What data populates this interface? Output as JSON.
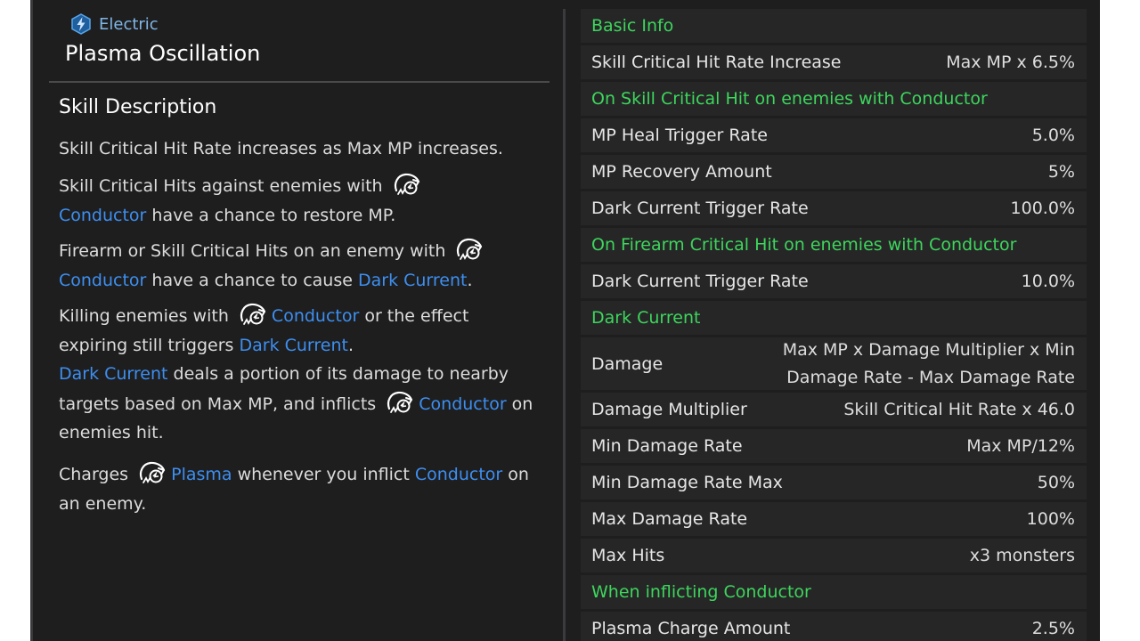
{
  "header": {
    "element_label": "Electric",
    "element_icon": "electric-bolt-icon",
    "skill_name": "Plasma Oscillation"
  },
  "description": {
    "title": "Skill Description",
    "p1": "Skill Critical Hit Rate increases as Max MP increases.",
    "p2_a": "Skill Critical Hits against enemies with",
    "p2_link": "Conductor",
    "p2_b": " have a chance to restore MP.",
    "p3_a": "Firearm or Skill Critical Hits on an enemy with",
    "p3_link1": "Conductor",
    "p3_b": " have a chance to cause ",
    "p3_link2": "Dark Current",
    "p3_c": ".",
    "p4_a": "Killing enemies with",
    "p4_link1": "Conductor",
    "p4_b": " or the effect expiring still triggers ",
    "p4_link2": "Dark Current",
    "p4_c": ".",
    "p5_link1": "Dark Current",
    "p5_a": " deals a portion of its damage to nearby targets based on Max MP, and inflicts",
    "p5_link2": "Conductor",
    "p5_b": " on enemies hit.",
    "p6_a": "Charges",
    "p6_link1": "Plasma",
    "p6_b": " whenever you inflict ",
    "p6_link2": "Conductor",
    "p6_c": " on an enemy."
  },
  "stats": {
    "sec_basic": "Basic Info",
    "r1_label": "Skill Critical Hit Rate Increase",
    "r1_value": "Max MP x 6.5%",
    "sec_skill_crit": "On Skill Critical Hit on enemies with Conductor",
    "r2_label": "MP Heal Trigger Rate",
    "r2_value": "5.0%",
    "r3_label": "MP Recovery Amount",
    "r3_value": "5%",
    "r4_label": "Dark Current Trigger Rate",
    "r4_value": "100.0%",
    "sec_firearm_crit": "On Firearm Critical Hit on enemies with Conductor",
    "r5_label": "Dark Current Trigger Rate",
    "r5_value": "10.0%",
    "sec_dark_current": "Dark Current",
    "r6_label": "Damage",
    "r6_value_line1": "Max MP x Damage Multiplier x Min",
    "r6_value_line2": "Damage Rate - Max Damage Rate",
    "r7_label": "Damage Multiplier",
    "r7_value": "Skill Critical Hit Rate x 46.0",
    "r8_label": "Min Damage Rate",
    "r8_value": "Max MP/12%",
    "r9_label": "Min Damage Rate Max",
    "r9_value": "50%",
    "r10_label": "Max Damage Rate",
    "r10_value": "100%",
    "r11_label": "Max Hits",
    "r11_value": "x3 monsters",
    "sec_inflicting": "When inflicting Conductor",
    "r12_label": "Plasma Charge Amount",
    "r12_value": "2.5%"
  },
  "icons": {
    "conductor": "conductor-icon",
    "plasma": "plasma-icon"
  },
  "colors": {
    "panel_bg": "#1e1e1f",
    "row_bg": "#262627",
    "section_green": "#3dd65c",
    "link_blue": "#3d8ff0",
    "element_blue": "#7fb7e6"
  }
}
